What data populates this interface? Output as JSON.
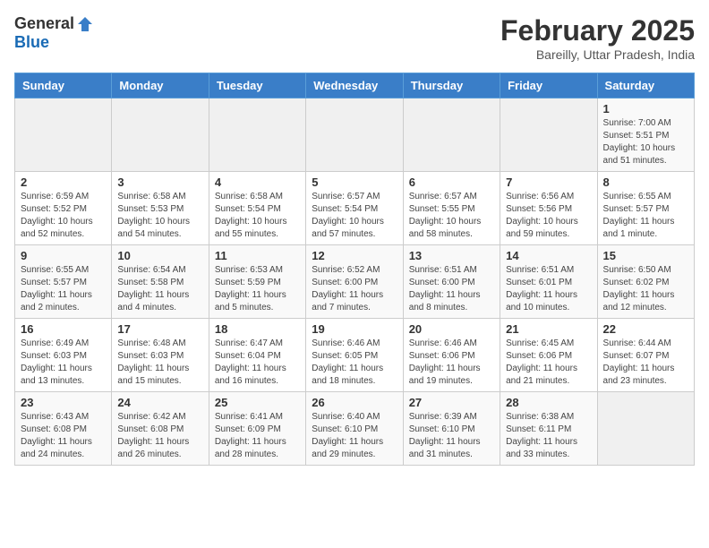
{
  "header": {
    "logo_general": "General",
    "logo_blue": "Blue",
    "month_year": "February 2025",
    "location": "Bareilly, Uttar Pradesh, India"
  },
  "weekdays": [
    "Sunday",
    "Monday",
    "Tuesday",
    "Wednesday",
    "Thursday",
    "Friday",
    "Saturday"
  ],
  "weeks": [
    [
      {
        "day": "",
        "sunrise": "",
        "sunset": "",
        "daylight": ""
      },
      {
        "day": "",
        "sunrise": "",
        "sunset": "",
        "daylight": ""
      },
      {
        "day": "",
        "sunrise": "",
        "sunset": "",
        "daylight": ""
      },
      {
        "day": "",
        "sunrise": "",
        "sunset": "",
        "daylight": ""
      },
      {
        "day": "",
        "sunrise": "",
        "sunset": "",
        "daylight": ""
      },
      {
        "day": "",
        "sunrise": "",
        "sunset": "",
        "daylight": ""
      },
      {
        "day": "1",
        "sunrise": "7:00 AM",
        "sunset": "5:51 PM",
        "daylight": "10 hours and 51 minutes."
      }
    ],
    [
      {
        "day": "2",
        "sunrise": "6:59 AM",
        "sunset": "5:52 PM",
        "daylight": "10 hours and 52 minutes."
      },
      {
        "day": "3",
        "sunrise": "6:58 AM",
        "sunset": "5:53 PM",
        "daylight": "10 hours and 54 minutes."
      },
      {
        "day": "4",
        "sunrise": "6:58 AM",
        "sunset": "5:54 PM",
        "daylight": "10 hours and 55 minutes."
      },
      {
        "day": "5",
        "sunrise": "6:57 AM",
        "sunset": "5:54 PM",
        "daylight": "10 hours and 57 minutes."
      },
      {
        "day": "6",
        "sunrise": "6:57 AM",
        "sunset": "5:55 PM",
        "daylight": "10 hours and 58 minutes."
      },
      {
        "day": "7",
        "sunrise": "6:56 AM",
        "sunset": "5:56 PM",
        "daylight": "10 hours and 59 minutes."
      },
      {
        "day": "8",
        "sunrise": "6:55 AM",
        "sunset": "5:57 PM",
        "daylight": "11 hours and 1 minute."
      }
    ],
    [
      {
        "day": "9",
        "sunrise": "6:55 AM",
        "sunset": "5:57 PM",
        "daylight": "11 hours and 2 minutes."
      },
      {
        "day": "10",
        "sunrise": "6:54 AM",
        "sunset": "5:58 PM",
        "daylight": "11 hours and 4 minutes."
      },
      {
        "day": "11",
        "sunrise": "6:53 AM",
        "sunset": "5:59 PM",
        "daylight": "11 hours and 5 minutes."
      },
      {
        "day": "12",
        "sunrise": "6:52 AM",
        "sunset": "6:00 PM",
        "daylight": "11 hours and 7 minutes."
      },
      {
        "day": "13",
        "sunrise": "6:51 AM",
        "sunset": "6:00 PM",
        "daylight": "11 hours and 8 minutes."
      },
      {
        "day": "14",
        "sunrise": "6:51 AM",
        "sunset": "6:01 PM",
        "daylight": "11 hours and 10 minutes."
      },
      {
        "day": "15",
        "sunrise": "6:50 AM",
        "sunset": "6:02 PM",
        "daylight": "11 hours and 12 minutes."
      }
    ],
    [
      {
        "day": "16",
        "sunrise": "6:49 AM",
        "sunset": "6:03 PM",
        "daylight": "11 hours and 13 minutes."
      },
      {
        "day": "17",
        "sunrise": "6:48 AM",
        "sunset": "6:03 PM",
        "daylight": "11 hours and 15 minutes."
      },
      {
        "day": "18",
        "sunrise": "6:47 AM",
        "sunset": "6:04 PM",
        "daylight": "11 hours and 16 minutes."
      },
      {
        "day": "19",
        "sunrise": "6:46 AM",
        "sunset": "6:05 PM",
        "daylight": "11 hours and 18 minutes."
      },
      {
        "day": "20",
        "sunrise": "6:46 AM",
        "sunset": "6:06 PM",
        "daylight": "11 hours and 19 minutes."
      },
      {
        "day": "21",
        "sunrise": "6:45 AM",
        "sunset": "6:06 PM",
        "daylight": "11 hours and 21 minutes."
      },
      {
        "day": "22",
        "sunrise": "6:44 AM",
        "sunset": "6:07 PM",
        "daylight": "11 hours and 23 minutes."
      }
    ],
    [
      {
        "day": "23",
        "sunrise": "6:43 AM",
        "sunset": "6:08 PM",
        "daylight": "11 hours and 24 minutes."
      },
      {
        "day": "24",
        "sunrise": "6:42 AM",
        "sunset": "6:08 PM",
        "daylight": "11 hours and 26 minutes."
      },
      {
        "day": "25",
        "sunrise": "6:41 AM",
        "sunset": "6:09 PM",
        "daylight": "11 hours and 28 minutes."
      },
      {
        "day": "26",
        "sunrise": "6:40 AM",
        "sunset": "6:10 PM",
        "daylight": "11 hours and 29 minutes."
      },
      {
        "day": "27",
        "sunrise": "6:39 AM",
        "sunset": "6:10 PM",
        "daylight": "11 hours and 31 minutes."
      },
      {
        "day": "28",
        "sunrise": "6:38 AM",
        "sunset": "6:11 PM",
        "daylight": "11 hours and 33 minutes."
      },
      {
        "day": "",
        "sunrise": "",
        "sunset": "",
        "daylight": ""
      }
    ]
  ]
}
